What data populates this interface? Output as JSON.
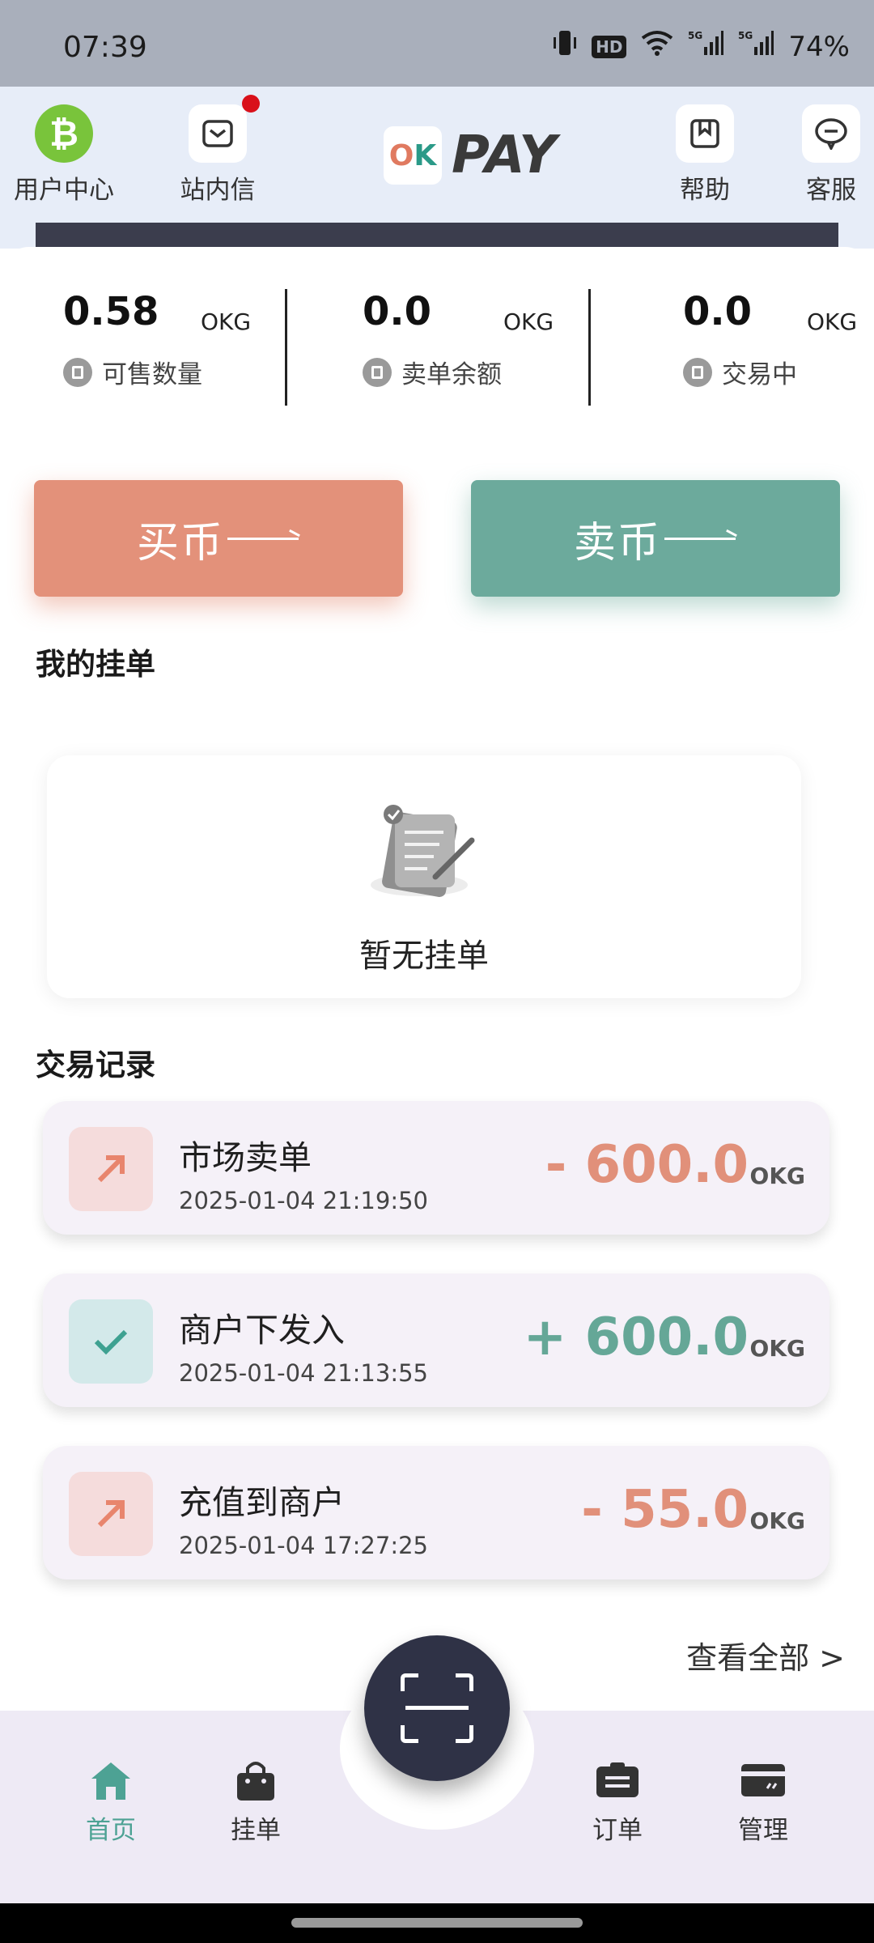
{
  "status_bar": {
    "time": "07:39",
    "battery": "74%",
    "network_1": "5G",
    "network_2": "5G",
    "hd": "HD"
  },
  "header": {
    "user_center": "用户中心",
    "inbox": "站内信",
    "logo_text": "PAY",
    "logo_mark_o": "O",
    "logo_mark_k": "K",
    "help": "帮助",
    "service": "客服",
    "btc_symbol": "₿"
  },
  "stats": [
    {
      "value": "0.58",
      "unit": "OKG",
      "label": "可售数量",
      "icon": "coin-icon"
    },
    {
      "value": "0.0",
      "unit": "OKG",
      "label": "卖单余额",
      "icon": "document-icon"
    },
    {
      "value": "0.0",
      "unit": "OKG",
      "label": "交易中",
      "icon": "wallet-icon"
    }
  ],
  "actions": {
    "buy_label": "买币",
    "sell_label": "卖币"
  },
  "my_orders": {
    "title": "我的挂单",
    "empty_text": "暂无挂单"
  },
  "records": {
    "title": "交易记录",
    "items": [
      {
        "title": "市场卖单",
        "time": "2025-01-04 21:19:50",
        "amount": "- 600.0",
        "unit": "OKG",
        "type": "out"
      },
      {
        "title": "商户下发入",
        "time": "2025-01-04 21:13:55",
        "amount": "+ 600.0",
        "unit": "OKG",
        "type": "in"
      },
      {
        "title": "充值到商户",
        "time": "2025-01-04 17:27:25",
        "amount": "- 55.0",
        "unit": "OKG",
        "type": "out"
      }
    ],
    "view_all": "查看全部 >"
  },
  "bottom_nav": {
    "home": "首页",
    "listings": "挂单",
    "orders": "订单",
    "manage": "管理"
  },
  "colors": {
    "accent_green": "#4da294",
    "buy": "#e3917a",
    "sell": "#6caa9c",
    "dark": "#2f3246"
  }
}
